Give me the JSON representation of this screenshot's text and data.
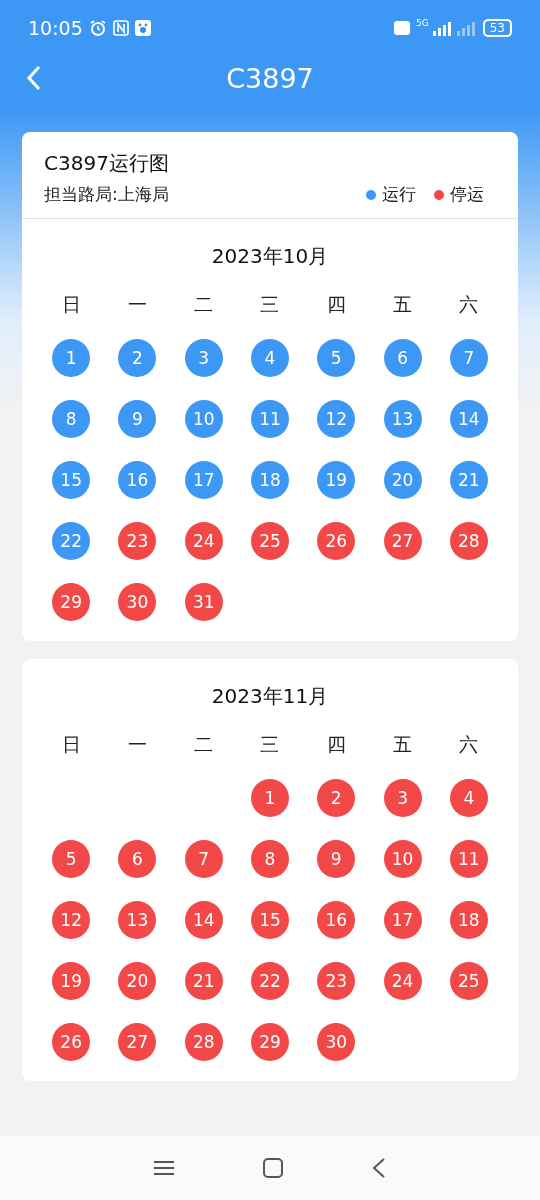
{
  "status_bar": {
    "time": "10:05",
    "network": "5G",
    "battery": "53"
  },
  "header": {
    "title": "C3897"
  },
  "info": {
    "title": "C3897运行图",
    "bureau": "担当路局:上海局",
    "legend": [
      {
        "label": "运行",
        "color": "#3d98f5"
      },
      {
        "label": "停运",
        "color": "#f24848"
      }
    ]
  },
  "months": [
    {
      "title": "2023年10月",
      "weekdays": [
        "日",
        "一",
        "二",
        "三",
        "四",
        "五",
        "六"
      ],
      "cells": [
        {
          "kind": "day",
          "day": "1",
          "running": true
        },
        {
          "kind": "day",
          "day": "2",
          "running": true
        },
        {
          "kind": "day",
          "day": "3",
          "running": true
        },
        {
          "kind": "day",
          "day": "4",
          "running": true
        },
        {
          "kind": "day",
          "day": "5",
          "running": true
        },
        {
          "kind": "day",
          "day": "6",
          "running": true
        },
        {
          "kind": "day",
          "day": "7",
          "running": true
        },
        {
          "kind": "day",
          "day": "8",
          "running": true
        },
        {
          "kind": "day",
          "day": "9",
          "running": true
        },
        {
          "kind": "day",
          "day": "10",
          "running": true
        },
        {
          "kind": "day",
          "day": "11",
          "running": true
        },
        {
          "kind": "day",
          "day": "12",
          "running": true
        },
        {
          "kind": "day",
          "day": "13",
          "running": true
        },
        {
          "kind": "day",
          "day": "14",
          "running": true
        },
        {
          "kind": "day",
          "day": "15",
          "running": true
        },
        {
          "kind": "day",
          "day": "16",
          "running": true
        },
        {
          "kind": "day",
          "day": "17",
          "running": true
        },
        {
          "kind": "day",
          "day": "18",
          "running": true
        },
        {
          "kind": "day",
          "day": "19",
          "running": true
        },
        {
          "kind": "day",
          "day": "20",
          "running": true
        },
        {
          "kind": "day",
          "day": "21",
          "running": true
        },
        {
          "kind": "day",
          "day": "22",
          "running": true
        },
        {
          "kind": "day",
          "day": "23",
          "running": false
        },
        {
          "kind": "day",
          "day": "24",
          "running": false
        },
        {
          "kind": "day",
          "day": "25",
          "running": false
        },
        {
          "kind": "day",
          "day": "26",
          "running": false
        },
        {
          "kind": "day",
          "day": "27",
          "running": false
        },
        {
          "kind": "day",
          "day": "28",
          "running": false
        },
        {
          "kind": "day",
          "day": "29",
          "running": false
        },
        {
          "kind": "day",
          "day": "30",
          "running": false
        },
        {
          "kind": "day",
          "day": "31",
          "running": false
        }
      ]
    },
    {
      "title": "2023年11月",
      "weekdays": [
        "日",
        "一",
        "二",
        "三",
        "四",
        "五",
        "六"
      ],
      "cells": [
        {
          "kind": "blank"
        },
        {
          "kind": "blank"
        },
        {
          "kind": "blank"
        },
        {
          "kind": "day",
          "day": "1",
          "running": false
        },
        {
          "kind": "day",
          "day": "2",
          "running": false
        },
        {
          "kind": "day",
          "day": "3",
          "running": false
        },
        {
          "kind": "day",
          "day": "4",
          "running": false
        },
        {
          "kind": "day",
          "day": "5",
          "running": false
        },
        {
          "kind": "day",
          "day": "6",
          "running": false
        },
        {
          "kind": "day",
          "day": "7",
          "running": false
        },
        {
          "kind": "day",
          "day": "8",
          "running": false
        },
        {
          "kind": "day",
          "day": "9",
          "running": false
        },
        {
          "kind": "day",
          "day": "10",
          "running": false
        },
        {
          "kind": "day",
          "day": "11",
          "running": false
        },
        {
          "kind": "day",
          "day": "12",
          "running": false
        },
        {
          "kind": "day",
          "day": "13",
          "running": false
        },
        {
          "kind": "day",
          "day": "14",
          "running": false
        },
        {
          "kind": "day",
          "day": "15",
          "running": false
        },
        {
          "kind": "day",
          "day": "16",
          "running": false
        },
        {
          "kind": "day",
          "day": "17",
          "running": false
        },
        {
          "kind": "day",
          "day": "18",
          "running": false
        },
        {
          "kind": "day",
          "day": "19",
          "running": false
        },
        {
          "kind": "day",
          "day": "20",
          "running": false
        },
        {
          "kind": "day",
          "day": "21",
          "running": false
        },
        {
          "kind": "day",
          "day": "22",
          "running": false
        },
        {
          "kind": "day",
          "day": "23",
          "running": false
        },
        {
          "kind": "day",
          "day": "24",
          "running": false
        },
        {
          "kind": "day",
          "day": "25",
          "running": false
        },
        {
          "kind": "day",
          "day": "26",
          "running": false
        },
        {
          "kind": "day",
          "day": "27",
          "running": false
        },
        {
          "kind": "day",
          "day": "28",
          "running": false
        },
        {
          "kind": "day",
          "day": "29",
          "running": false
        },
        {
          "kind": "day",
          "day": "30",
          "running": false
        }
      ]
    }
  ]
}
